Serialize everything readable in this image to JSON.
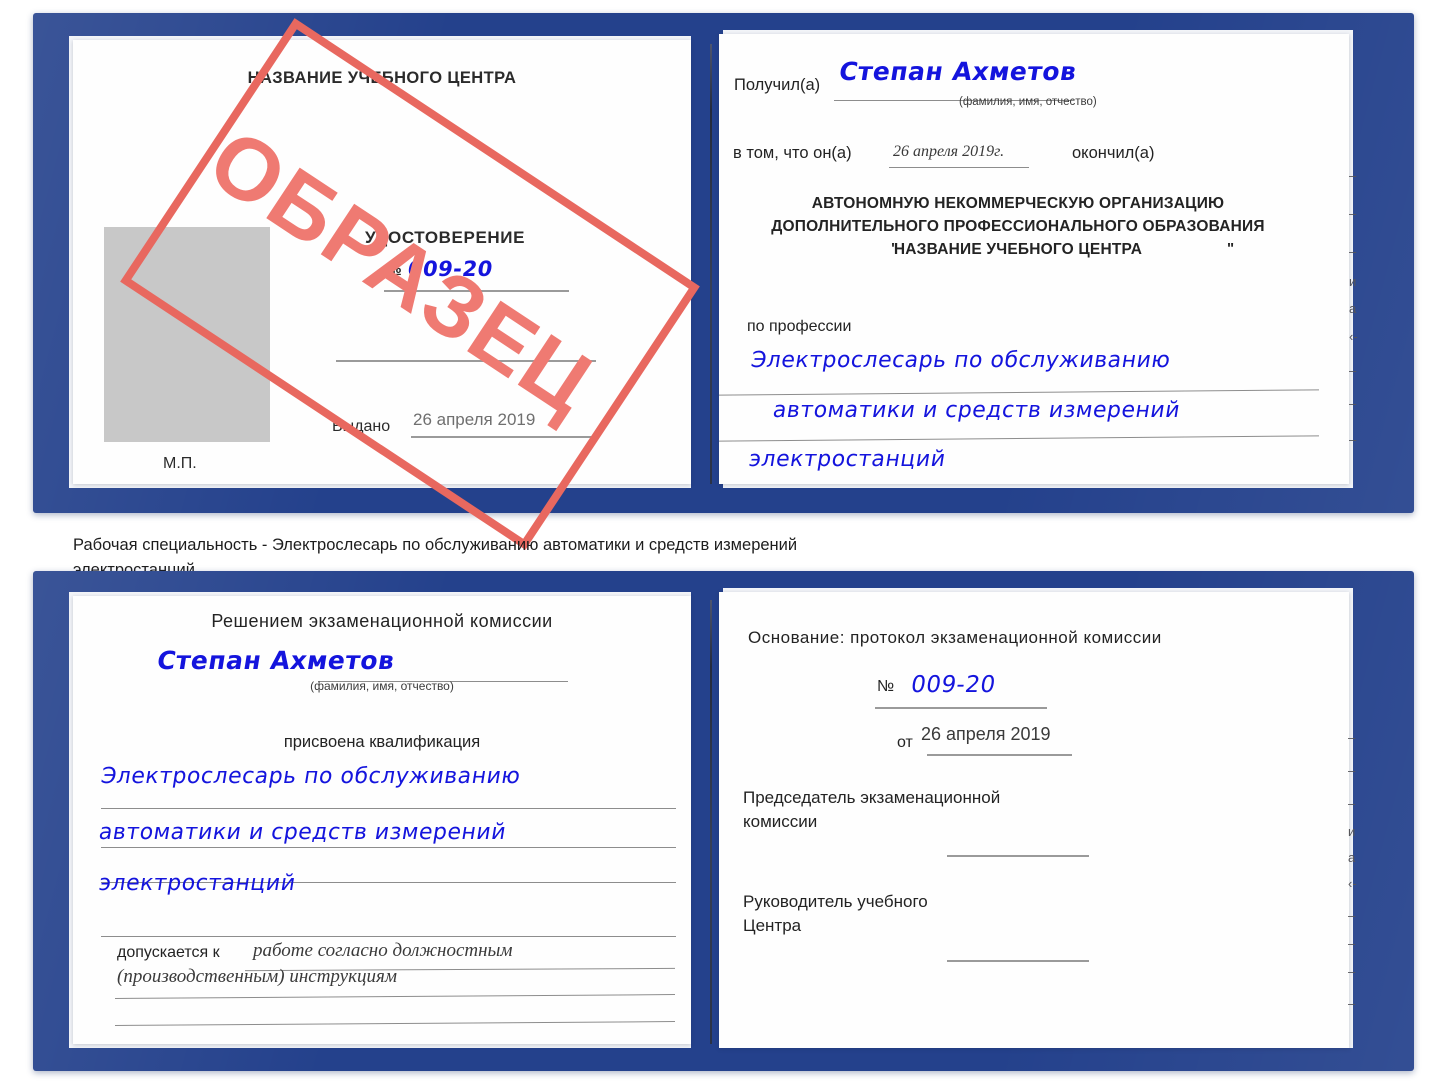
{
  "document": {
    "type": "certificate-scan",
    "language": "ru",
    "watermark": "ОБРАЗЕЦ",
    "colors": {
      "cover": "#24418c",
      "watermark": "#e8685f",
      "handwriting": "#1414dd",
      "photo_placeholder": "#c8c8c8"
    }
  },
  "caption": {
    "line1": "Рабочая специальность - Электрослесарь по обслуживанию автоматики и средств измерений",
    "line2": "электростанций"
  },
  "certificate_top": {
    "left_page": {
      "heading": "НАЗВАНИЕ УЧЕБНОГО ЦЕНТРА",
      "title": "УДОСТОВЕРЕНИЕ",
      "number_label": "№",
      "number_value": "009-20",
      "issued_label": "Выдано",
      "issued_value": "26 апреля 2019",
      "seal_label": "М.П.",
      "photo_placeholder": "photo-box"
    },
    "right_page": {
      "received_label": "Получил(а)",
      "received_value": "Степан Ахметов",
      "fio_hint": "(фамилия, имя, отчество)",
      "in_that_label": "в том, что он(а)",
      "date_value": "26 апреля 2019г.",
      "finished_label": "окончил(а)",
      "org_line1": "АВТОНОМНУЮ НЕКОММЕРЧЕСКУЮ ОРГАНИЗАЦИЮ",
      "org_line2": "ДОПОЛНИТЕЛЬНОГО ПРОФЕССИОНАЛЬНОГО ОБРАЗОВАНИЯ",
      "org_quote_open": "\"",
      "org_line3": "НАЗВАНИЕ УЧЕБНОГО ЦЕНТРА",
      "org_quote_close": "\"",
      "profession_label": "по профессии",
      "profession_line1": "Электрослесарь по обслуживанию",
      "profession_line2": "автоматики и средств измерений",
      "profession_line3": "электростанций",
      "bleed_marks": [
        "–",
        "–",
        "–",
        "и",
        "а",
        "‹-",
        "–",
        "–",
        "–"
      ]
    }
  },
  "certificate_bottom": {
    "left_page": {
      "heading": "Решением экзаменационной комиссии",
      "name_value": "Степан Ахметов",
      "fio_hint": "(фамилия, имя, отчество)",
      "qualification_label": "присвоена квалификация",
      "qualification_line1": "Электрослесарь по обслуживанию",
      "qualification_line2": "автоматики и средств измерений",
      "qualification_line3": "электростанций",
      "allowed_label": "допускается к",
      "allowed_value_line1": "работе согласно должностным",
      "allowed_value_line2": "(производственным) инструкциям"
    },
    "right_page": {
      "basis_label": "Основание: протокол экзаменационной комиссии",
      "number_label": "№",
      "number_value": "009-20",
      "date_label": "от",
      "date_value": "26 апреля 2019",
      "chairman_line1": "Председатель экзаменационной",
      "chairman_line2": "комиссии",
      "head_line1": "Руководитель учебного",
      "head_line2": "Центра",
      "bleed_marks": [
        "–",
        "–",
        "–",
        "и",
        "а",
        "‹-",
        "–",
        "–",
        "–",
        "–"
      ]
    }
  }
}
